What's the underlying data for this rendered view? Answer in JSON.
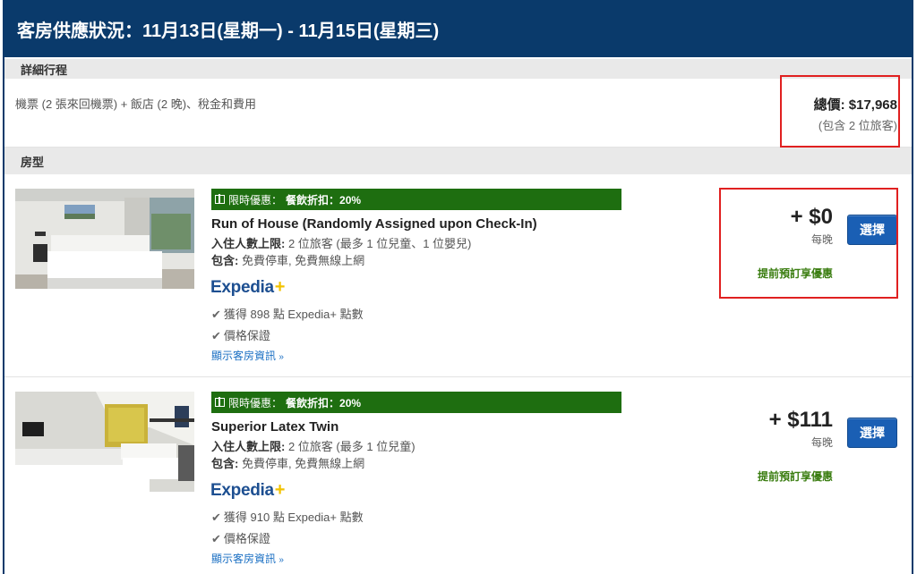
{
  "header": {
    "title": "客房供應狀況：11月13日(星期一) - 11月15日(星期三)"
  },
  "itinerary": {
    "section_label": "詳細行程",
    "description": "機票 (2 張來回機票) + 飯店 (2 晚)、稅金和費用",
    "total_label": "總價: $17,968",
    "total_note": "(包含 2 位旅客)"
  },
  "room_section": {
    "label": "房型"
  },
  "rooms": [
    {
      "promo_label": "限時優惠：",
      "promo_detail": "餐飲折扣：20%",
      "name": "Run of House (Randomly Assigned upon Check-In)",
      "occupancy_label": "入住人數上限:",
      "occupancy_value": " 2 位旅客 (最多 1 位兒童、1 位嬰兒)",
      "includes_label": "包含:",
      "includes_value": " 免費停車, 免費無線上網",
      "brand_name": "Expedia",
      "brand_plus": "+",
      "points": "獲得 898 點 Expedia+ 點數",
      "guarantee": "價格保證",
      "more_link": "顯示客房資訊",
      "price": "+ $0",
      "per_night": "每晚",
      "early_booking": "提前預訂享優惠",
      "select_label": "選擇"
    },
    {
      "promo_label": "限時優惠：",
      "promo_detail": "餐飲折扣：20%",
      "name": "Superior Latex Twin",
      "occupancy_label": "入住人數上限:",
      "occupancy_value": " 2 位旅客 (最多 1 位兒童)",
      "includes_label": "包含:",
      "includes_value": " 免費停車, 免費無線上網",
      "brand_name": "Expedia",
      "brand_plus": "+",
      "points": "獲得 910 點 Expedia+ 點數",
      "guarantee": "價格保證",
      "more_link": "顯示客房資訊",
      "price": "+ $111",
      "per_night": "每晚",
      "early_booking": "提前預訂享優惠",
      "select_label": "選擇"
    }
  ],
  "colors": {
    "header_bg": "#0a3a6b",
    "promo_green": "#1e6e10",
    "select_blue": "#1a5fb4",
    "highlight_red": "#e02020",
    "link_blue": "#1a6fc3"
  },
  "icons": [
    "gift-icon",
    "checkmark-icon",
    "chevron-down-icon"
  ]
}
